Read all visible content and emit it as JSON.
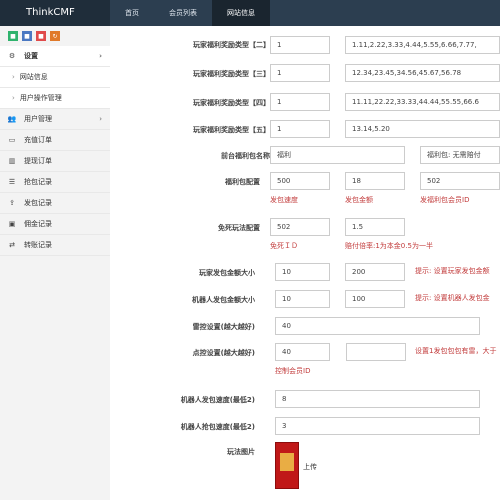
{
  "topbar": {
    "brand": "ThinkCMF",
    "nav": [
      "首页",
      "会员列表",
      "网站信息"
    ]
  },
  "sidebar": {
    "quick_icons": [
      "lock-icon",
      "trash-icon",
      "file-icon",
      "refresh-icon"
    ],
    "items": [
      {
        "icon": "gear-icon",
        "label": "设置"
      },
      {
        "label": "网站信息"
      },
      {
        "label": "用户操作管理"
      },
      {
        "icon": "users-icon",
        "label": "用户管理"
      },
      {
        "icon": "credit-card-icon",
        "label": "充值订单"
      },
      {
        "icon": "bar-chart-icon",
        "label": "提现订单"
      },
      {
        "icon": "list-icon",
        "label": "抢包记录"
      },
      {
        "icon": "upload-icon",
        "label": "发包记录"
      },
      {
        "icon": "money-icon",
        "label": "佣金记录"
      },
      {
        "icon": "exchange-icon",
        "label": "转账记录"
      }
    ]
  },
  "form": {
    "reward_type_2": {
      "label": "玩家福利奖励类型【二】",
      "val1": "1",
      "val2": "1.11,2.22,3.33,4.44,5.55,6.66,7.77,"
    },
    "reward_type_3": {
      "label": "玩家福利奖励类型【三】",
      "val1": "1",
      "val2": "12.34,23.45,34.56,45.67,56.78"
    },
    "reward_type_4": {
      "label": "玩家福利奖励类型【四】",
      "val1": "1",
      "val2": "11.11,22.22,33.33,44.44,55.55,66.6"
    },
    "reward_type_5": {
      "label": "玩家福利奖励类型【五】",
      "val1": "1",
      "val2": "13.14,5.20"
    },
    "welfare_name": {
      "label": "前台福利包名称",
      "value": "福利",
      "value2": "福利包: 无需赔付"
    },
    "welfare_config": {
      "label": "福利包配置",
      "v1": "500",
      "v2": "18",
      "v3": "502",
      "n1": "发包速度",
      "n2": "发包金额",
      "n3": "发福利包会员ID"
    },
    "free_death": {
      "label": "免死玩法配置",
      "v1": "502",
      "v2": "1.5",
      "n1": "免死ＩＤ",
      "n2": "赔付倍率:1为本金0.5为一半"
    },
    "player_size": {
      "label": "玩家发包金额大小",
      "v1": "10",
      "v2": "200",
      "hint": "提示: 设置玩家发包金额"
    },
    "robot_size": {
      "label": "机器人发包金额大小",
      "v1": "10",
      "v2": "100",
      "hint": "提示: 设置机器人发包金"
    },
    "mine_level": {
      "label": "雷控设置(越大越好)",
      "value": "40"
    },
    "point_level": {
      "label": "点控设置(越大越好)",
      "v1": "40",
      "v2": "",
      "hint": "设置1发包包包有雷，大于",
      "note": "控制会员ID"
    },
    "robot_send_speed": {
      "label": "机器人发包速度(最低2)",
      "value": "8"
    },
    "robot_grab_speed": {
      "label": "机器人抢包速度(最低2)",
      "value": "3"
    },
    "play_image": {
      "label": "玩法图片",
      "upload": "上传"
    }
  }
}
